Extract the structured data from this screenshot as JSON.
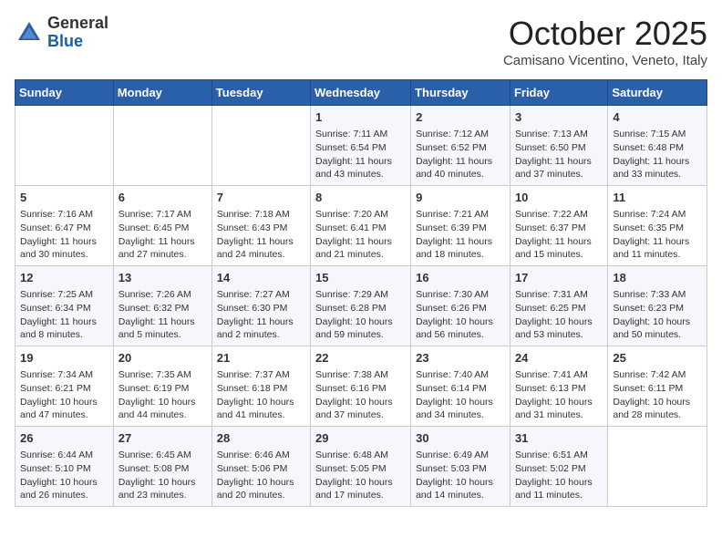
{
  "header": {
    "logo_general": "General",
    "logo_blue": "Blue",
    "month_title": "October 2025",
    "location": "Camisano Vicentino, Veneto, Italy"
  },
  "days_of_week": [
    "Sunday",
    "Monday",
    "Tuesday",
    "Wednesday",
    "Thursday",
    "Friday",
    "Saturday"
  ],
  "weeks": [
    [
      {
        "day": null,
        "info": null
      },
      {
        "day": null,
        "info": null
      },
      {
        "day": null,
        "info": null
      },
      {
        "day": "1",
        "info": "Sunrise: 7:11 AM\nSunset: 6:54 PM\nDaylight: 11 hours and 43 minutes."
      },
      {
        "day": "2",
        "info": "Sunrise: 7:12 AM\nSunset: 6:52 PM\nDaylight: 11 hours and 40 minutes."
      },
      {
        "day": "3",
        "info": "Sunrise: 7:13 AM\nSunset: 6:50 PM\nDaylight: 11 hours and 37 minutes."
      },
      {
        "day": "4",
        "info": "Sunrise: 7:15 AM\nSunset: 6:48 PM\nDaylight: 11 hours and 33 minutes."
      }
    ],
    [
      {
        "day": "5",
        "info": "Sunrise: 7:16 AM\nSunset: 6:47 PM\nDaylight: 11 hours and 30 minutes."
      },
      {
        "day": "6",
        "info": "Sunrise: 7:17 AM\nSunset: 6:45 PM\nDaylight: 11 hours and 27 minutes."
      },
      {
        "day": "7",
        "info": "Sunrise: 7:18 AM\nSunset: 6:43 PM\nDaylight: 11 hours and 24 minutes."
      },
      {
        "day": "8",
        "info": "Sunrise: 7:20 AM\nSunset: 6:41 PM\nDaylight: 11 hours and 21 minutes."
      },
      {
        "day": "9",
        "info": "Sunrise: 7:21 AM\nSunset: 6:39 PM\nDaylight: 11 hours and 18 minutes."
      },
      {
        "day": "10",
        "info": "Sunrise: 7:22 AM\nSunset: 6:37 PM\nDaylight: 11 hours and 15 minutes."
      },
      {
        "day": "11",
        "info": "Sunrise: 7:24 AM\nSunset: 6:35 PM\nDaylight: 11 hours and 11 minutes."
      }
    ],
    [
      {
        "day": "12",
        "info": "Sunrise: 7:25 AM\nSunset: 6:34 PM\nDaylight: 11 hours and 8 minutes."
      },
      {
        "day": "13",
        "info": "Sunrise: 7:26 AM\nSunset: 6:32 PM\nDaylight: 11 hours and 5 minutes."
      },
      {
        "day": "14",
        "info": "Sunrise: 7:27 AM\nSunset: 6:30 PM\nDaylight: 11 hours and 2 minutes."
      },
      {
        "day": "15",
        "info": "Sunrise: 7:29 AM\nSunset: 6:28 PM\nDaylight: 10 hours and 59 minutes."
      },
      {
        "day": "16",
        "info": "Sunrise: 7:30 AM\nSunset: 6:26 PM\nDaylight: 10 hours and 56 minutes."
      },
      {
        "day": "17",
        "info": "Sunrise: 7:31 AM\nSunset: 6:25 PM\nDaylight: 10 hours and 53 minutes."
      },
      {
        "day": "18",
        "info": "Sunrise: 7:33 AM\nSunset: 6:23 PM\nDaylight: 10 hours and 50 minutes."
      }
    ],
    [
      {
        "day": "19",
        "info": "Sunrise: 7:34 AM\nSunset: 6:21 PM\nDaylight: 10 hours and 47 minutes."
      },
      {
        "day": "20",
        "info": "Sunrise: 7:35 AM\nSunset: 6:19 PM\nDaylight: 10 hours and 44 minutes."
      },
      {
        "day": "21",
        "info": "Sunrise: 7:37 AM\nSunset: 6:18 PM\nDaylight: 10 hours and 41 minutes."
      },
      {
        "day": "22",
        "info": "Sunrise: 7:38 AM\nSunset: 6:16 PM\nDaylight: 10 hours and 37 minutes."
      },
      {
        "day": "23",
        "info": "Sunrise: 7:40 AM\nSunset: 6:14 PM\nDaylight: 10 hours and 34 minutes."
      },
      {
        "day": "24",
        "info": "Sunrise: 7:41 AM\nSunset: 6:13 PM\nDaylight: 10 hours and 31 minutes."
      },
      {
        "day": "25",
        "info": "Sunrise: 7:42 AM\nSunset: 6:11 PM\nDaylight: 10 hours and 28 minutes."
      }
    ],
    [
      {
        "day": "26",
        "info": "Sunrise: 6:44 AM\nSunset: 5:10 PM\nDaylight: 10 hours and 26 minutes."
      },
      {
        "day": "27",
        "info": "Sunrise: 6:45 AM\nSunset: 5:08 PM\nDaylight: 10 hours and 23 minutes."
      },
      {
        "day": "28",
        "info": "Sunrise: 6:46 AM\nSunset: 5:06 PM\nDaylight: 10 hours and 20 minutes."
      },
      {
        "day": "29",
        "info": "Sunrise: 6:48 AM\nSunset: 5:05 PM\nDaylight: 10 hours and 17 minutes."
      },
      {
        "day": "30",
        "info": "Sunrise: 6:49 AM\nSunset: 5:03 PM\nDaylight: 10 hours and 14 minutes."
      },
      {
        "day": "31",
        "info": "Sunrise: 6:51 AM\nSunset: 5:02 PM\nDaylight: 10 hours and 11 minutes."
      },
      {
        "day": null,
        "info": null
      }
    ]
  ]
}
